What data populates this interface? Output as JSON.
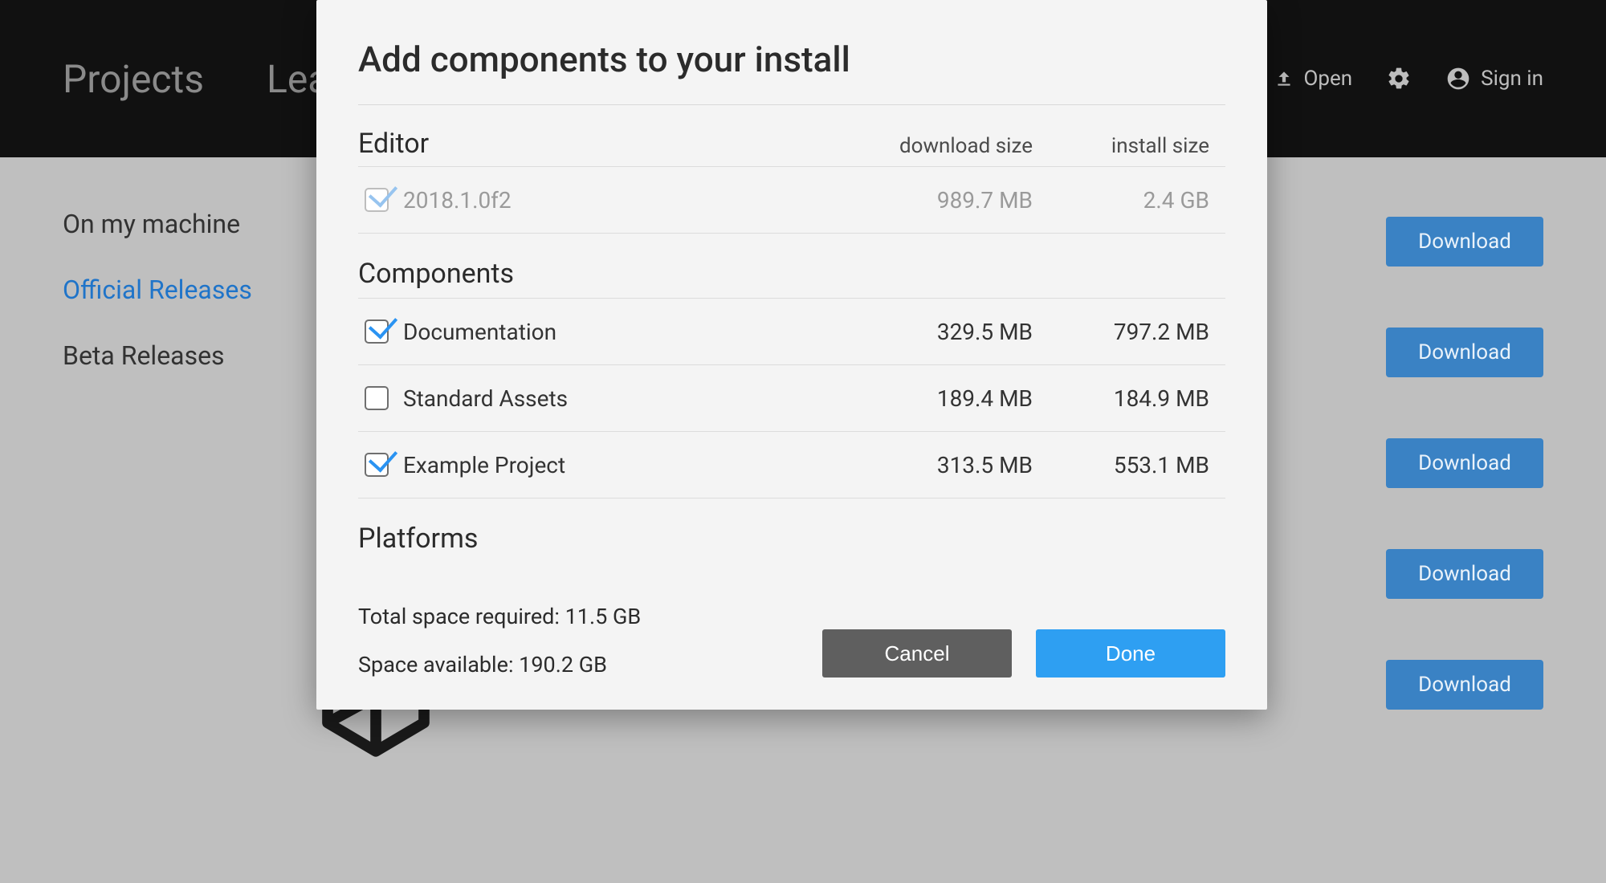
{
  "header": {
    "nav": {
      "projects": "Projects",
      "learn_partial": "Lea"
    },
    "open_label": "Open",
    "signin_label": "Sign in"
  },
  "sidebar": {
    "items": [
      {
        "label": "On my machine",
        "active": false
      },
      {
        "label": "Official Releases",
        "active": true
      },
      {
        "label": "Beta Releases",
        "active": false
      }
    ]
  },
  "downloads": {
    "button_label": "Download",
    "count": 5
  },
  "modal": {
    "title": "Add components to your install",
    "columns": {
      "download": "download size",
      "install": "install size"
    },
    "editor_section": "Editor",
    "components_section": "Components",
    "platforms_section": "Platforms",
    "editor": {
      "name": "2018.1.0f2",
      "download_size": "989.7 MB",
      "install_size": "2.4 GB",
      "checked": true,
      "disabled": true
    },
    "components": [
      {
        "name": "Documentation",
        "download_size": "329.5 MB",
        "install_size": "797.2 MB",
        "checked": true
      },
      {
        "name": "Standard Assets",
        "download_size": "189.4 MB",
        "install_size": "184.9 MB",
        "checked": false
      },
      {
        "name": "Example Project",
        "download_size": "313.5 MB",
        "install_size": "553.1 MB",
        "checked": true
      }
    ],
    "total_required_label": "Total space required: 11.5 GB",
    "space_available_label": "Space available: 190.2 GB",
    "cancel_label": "Cancel",
    "done_label": "Done"
  }
}
